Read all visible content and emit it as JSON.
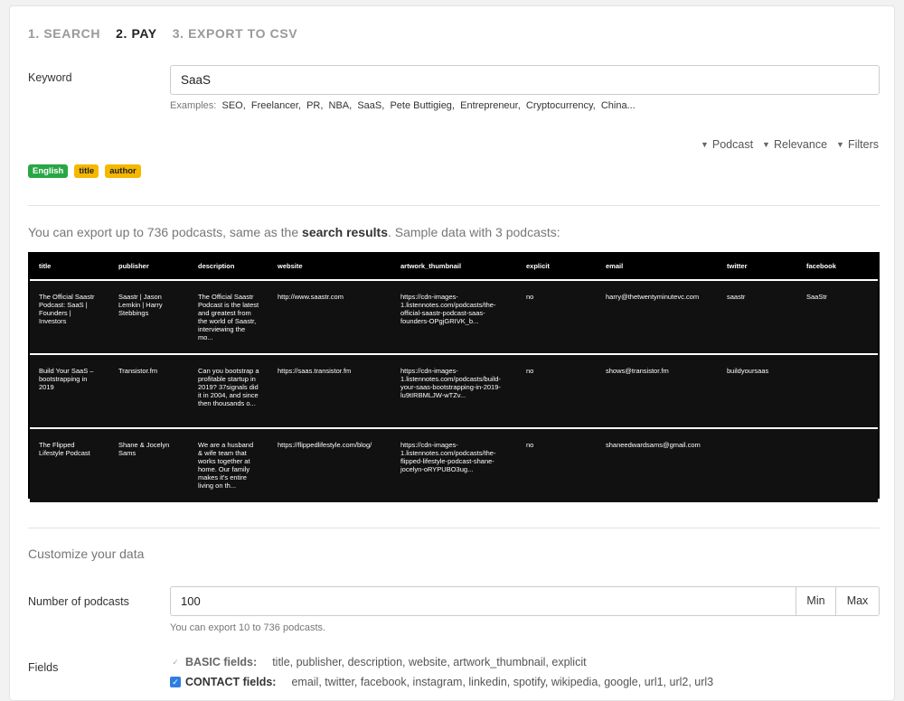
{
  "steps": [
    "1. SEARCH",
    "2. PAY",
    "3. EXPORT TO CSV"
  ],
  "keyword": {
    "label": "Keyword",
    "value": "SaaS"
  },
  "examples": {
    "prefix": "Examples:",
    "items": [
      "SEO,",
      "Freelancer,",
      "PR,",
      "NBA,",
      "SaaS,",
      "Pete Buttigieg,",
      "Entrepreneur,",
      "Cryptocurrency,",
      "China..."
    ]
  },
  "sort": {
    "podcast": "Podcast",
    "relevance": "Relevance",
    "filters": "Filters"
  },
  "tags": [
    "English",
    "title",
    "author"
  ],
  "export_info": {
    "pre": "You can export up to 736 podcasts, same as the ",
    "link": "search results",
    "post": ". Sample data with 3 podcasts:"
  },
  "table": {
    "headers": [
      "title",
      "publisher",
      "description",
      "website",
      "artwork_thumbnail",
      "explicit",
      "email",
      "twitter",
      "facebook"
    ],
    "rows": [
      [
        "The Official Saastr Podcast: SaaS | Founders | Investors",
        "Saastr | Jason Lemkin | Harry Stebbings",
        "The Official Saastr Podcast is the latest and greatest from the world of Saastr, interviewing the mo...",
        "http://www.saastr.com",
        "https://cdn-images-1.listennotes.com/podcasts/the-official-saastr-podcast-saas-founders-OPgjGRIVK_b...",
        "no",
        "harry@thetwentyminutevc.com",
        "saastr",
        "SaaStr"
      ],
      [
        "Build Your SaaS – bootstrapping in 2019",
        "Transistor.fm",
        "Can you bootstrap a profitable startup in 2019? 37signals did it in 2004, and since then thousands o...",
        "https://saas.transistor.fm",
        "https://cdn-images-1.listennotes.com/podcasts/build-your-saas-bootstrapping-in-2019-lu9tIRBMLJW-wTZv...",
        "no",
        "shows@transistor.fm",
        "buildyoursaas",
        ""
      ],
      [
        "The Flipped Lifestyle Podcast",
        "Shane & Jocelyn Sams",
        "We are a husband & wife team that works together at home. Our family makes it's entire living on th...",
        "https://flippedlifestyle.com/blog/",
        "https://cdn-images-1.listennotes.com/podcasts/the-flipped-lifestyle-podcast-shane-jocelyn-oRYPUBO3ug...",
        "no",
        "shaneedwardsams@gmail.com",
        "",
        ""
      ]
    ]
  },
  "customize": {
    "title": "Customize your data"
  },
  "num_podcasts": {
    "label": "Number of podcasts",
    "value": "100",
    "min": "Min",
    "max": "Max",
    "hint": "You can export 10 to 736 podcasts."
  },
  "fields": {
    "label": "Fields",
    "basic": {
      "name": "BASIC fields:",
      "list": "title, publisher, description, website, artwork_thumbnail, explicit"
    },
    "contact": {
      "name": "CONTACT fields:",
      "list": "email, twitter, facebook, instagram, linkedin, spotify, wikipedia, google, url1, url2, url3"
    }
  }
}
